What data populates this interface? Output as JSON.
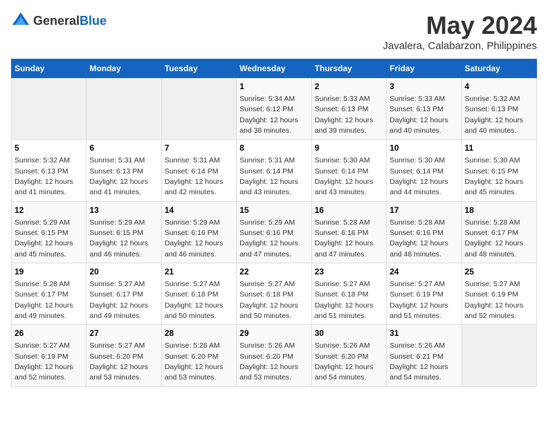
{
  "logo": {
    "general": "General",
    "blue": "Blue"
  },
  "title": "May 2024",
  "subtitle": "Javalera, Calabarzon, Philippines",
  "days_header": [
    "Sunday",
    "Monday",
    "Tuesday",
    "Wednesday",
    "Thursday",
    "Friday",
    "Saturday"
  ],
  "weeks": [
    {
      "cells": [
        {
          "day": "",
          "info": ""
        },
        {
          "day": "",
          "info": ""
        },
        {
          "day": "",
          "info": ""
        },
        {
          "day": "1",
          "info": "Sunrise: 5:34 AM\nSunset: 6:12 PM\nDaylight: 12 hours\nand 38 minutes."
        },
        {
          "day": "2",
          "info": "Sunrise: 5:33 AM\nSunset: 6:13 PM\nDaylight: 12 hours\nand 39 minutes."
        },
        {
          "day": "3",
          "info": "Sunrise: 5:33 AM\nSunset: 6:13 PM\nDaylight: 12 hours\nand 40 minutes."
        },
        {
          "day": "4",
          "info": "Sunrise: 5:32 AM\nSunset: 6:13 PM\nDaylight: 12 hours\nand 40 minutes."
        }
      ]
    },
    {
      "cells": [
        {
          "day": "5",
          "info": "Sunrise: 5:32 AM\nSunset: 6:13 PM\nDaylight: 12 hours\nand 41 minutes."
        },
        {
          "day": "6",
          "info": "Sunrise: 5:31 AM\nSunset: 6:13 PM\nDaylight: 12 hours\nand 41 minutes."
        },
        {
          "day": "7",
          "info": "Sunrise: 5:31 AM\nSunset: 6:14 PM\nDaylight: 12 hours\nand 42 minutes."
        },
        {
          "day": "8",
          "info": "Sunrise: 5:31 AM\nSunset: 6:14 PM\nDaylight: 12 hours\nand 43 minutes."
        },
        {
          "day": "9",
          "info": "Sunrise: 5:30 AM\nSunset: 6:14 PM\nDaylight: 12 hours\nand 43 minutes."
        },
        {
          "day": "10",
          "info": "Sunrise: 5:30 AM\nSunset: 6:14 PM\nDaylight: 12 hours\nand 44 minutes."
        },
        {
          "day": "11",
          "info": "Sunrise: 5:30 AM\nSunset: 6:15 PM\nDaylight: 12 hours\nand 45 minutes."
        }
      ]
    },
    {
      "cells": [
        {
          "day": "12",
          "info": "Sunrise: 5:29 AM\nSunset: 6:15 PM\nDaylight: 12 hours\nand 45 minutes."
        },
        {
          "day": "13",
          "info": "Sunrise: 5:29 AM\nSunset: 6:15 PM\nDaylight: 12 hours\nand 46 minutes."
        },
        {
          "day": "14",
          "info": "Sunrise: 5:29 AM\nSunset: 6:16 PM\nDaylight: 12 hours\nand 46 minutes."
        },
        {
          "day": "15",
          "info": "Sunrise: 5:29 AM\nSunset: 6:16 PM\nDaylight: 12 hours\nand 47 minutes."
        },
        {
          "day": "16",
          "info": "Sunrise: 5:28 AM\nSunset: 6:16 PM\nDaylight: 12 hours\nand 47 minutes."
        },
        {
          "day": "17",
          "info": "Sunrise: 5:28 AM\nSunset: 6:16 PM\nDaylight: 12 hours\nand 48 minutes."
        },
        {
          "day": "18",
          "info": "Sunrise: 5:28 AM\nSunset: 6:17 PM\nDaylight: 12 hours\nand 48 minutes."
        }
      ]
    },
    {
      "cells": [
        {
          "day": "19",
          "info": "Sunrise: 5:28 AM\nSunset: 6:17 PM\nDaylight: 12 hours\nand 49 minutes."
        },
        {
          "day": "20",
          "info": "Sunrise: 5:27 AM\nSunset: 6:17 PM\nDaylight: 12 hours\nand 49 minutes."
        },
        {
          "day": "21",
          "info": "Sunrise: 5:27 AM\nSunset: 6:18 PM\nDaylight: 12 hours\nand 50 minutes."
        },
        {
          "day": "22",
          "info": "Sunrise: 5:27 AM\nSunset: 6:18 PM\nDaylight: 12 hours\nand 50 minutes."
        },
        {
          "day": "23",
          "info": "Sunrise: 5:27 AM\nSunset: 6:18 PM\nDaylight: 12 hours\nand 51 minutes."
        },
        {
          "day": "24",
          "info": "Sunrise: 5:27 AM\nSunset: 6:19 PM\nDaylight: 12 hours\nand 51 minutes."
        },
        {
          "day": "25",
          "info": "Sunrise: 5:27 AM\nSunset: 6:19 PM\nDaylight: 12 hours\nand 52 minutes."
        }
      ]
    },
    {
      "cells": [
        {
          "day": "26",
          "info": "Sunrise: 5:27 AM\nSunset: 6:19 PM\nDaylight: 12 hours\nand 52 minutes."
        },
        {
          "day": "27",
          "info": "Sunrise: 5:27 AM\nSunset: 6:20 PM\nDaylight: 12 hours\nand 53 minutes."
        },
        {
          "day": "28",
          "info": "Sunrise: 5:26 AM\nSunset: 6:20 PM\nDaylight: 12 hours\nand 53 minutes."
        },
        {
          "day": "29",
          "info": "Sunrise: 5:26 AM\nSunset: 6:20 PM\nDaylight: 12 hours\nand 53 minutes."
        },
        {
          "day": "30",
          "info": "Sunrise: 5:26 AM\nSunset: 6:20 PM\nDaylight: 12 hours\nand 54 minutes."
        },
        {
          "day": "31",
          "info": "Sunrise: 5:26 AM\nSunset: 6:21 PM\nDaylight: 12 hours\nand 54 minutes."
        },
        {
          "day": "",
          "info": ""
        }
      ]
    }
  ]
}
